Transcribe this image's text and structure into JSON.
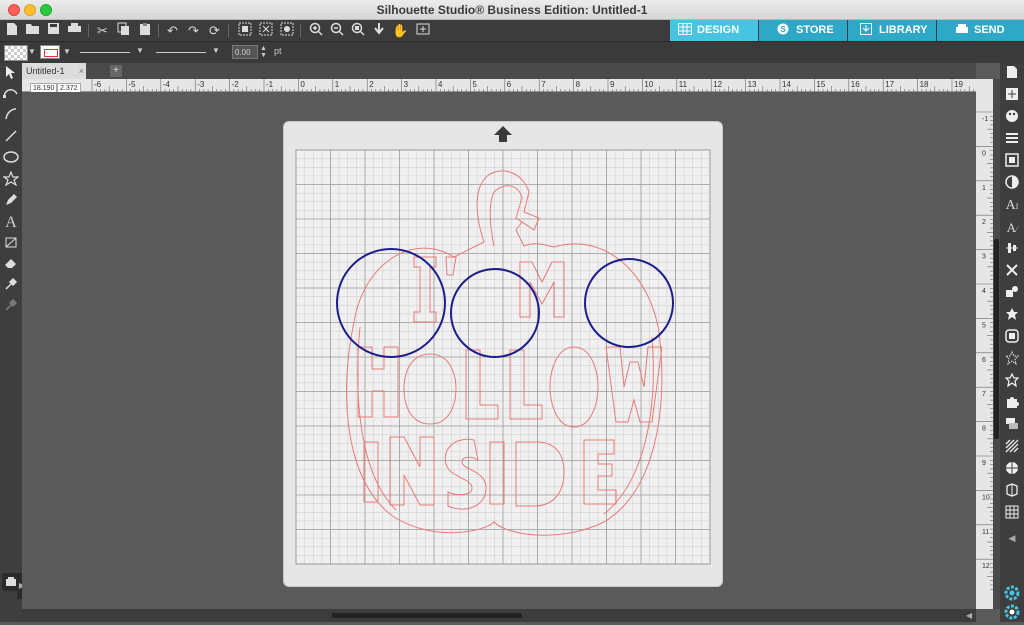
{
  "window": {
    "title": "Silhouette Studio® Business Edition: Untitled-1"
  },
  "nav_tabs": [
    {
      "label": "DESIGN",
      "active": true
    },
    {
      "label": "STORE",
      "active": false
    },
    {
      "label": "LIBRARY",
      "active": false
    },
    {
      "label": "SEND",
      "active": false
    }
  ],
  "toolbar": {
    "icons": [
      "new-icon",
      "open-icon",
      "save-icon",
      "print-icon",
      "cut-icon",
      "copy-icon",
      "paste-icon",
      "undo-icon",
      "redo-icon",
      "redraw-icon",
      "select-all-icon",
      "deselect-icon",
      "group-icon",
      "zoom-in-icon",
      "zoom-out-icon",
      "zoom-fit-icon",
      "move-down-icon",
      "pan-icon",
      "add-page-icon"
    ]
  },
  "props": {
    "line_width": "0.00",
    "line_unit": "pt"
  },
  "document": {
    "tab": "Untitled-1",
    "add_tab": "+"
  },
  "coords": {
    "x": "18.190",
    "y": "2.372"
  },
  "rulers": {
    "h": [
      "-6",
      "-5",
      "-4",
      "-3",
      "-2",
      "-1",
      "0",
      "1",
      "2",
      "3",
      "4",
      "5",
      "6",
      "7",
      "8",
      "9",
      "10",
      "11",
      "12",
      "13",
      "14",
      "15",
      "16",
      "17",
      "18",
      "19"
    ],
    "v": [
      "-1",
      "0",
      "1",
      "2",
      "3",
      "4",
      "5",
      "6",
      "7",
      "8",
      "9",
      "10",
      "11",
      "12"
    ]
  },
  "design": {
    "words": [
      "I'M",
      "HOLLOW",
      "INSIDE"
    ],
    "colors": {
      "guide": "#e87b78",
      "circle": "#1c1f8a",
      "grid": "#c4c4c4",
      "mat": "#f0f0f0"
    }
  },
  "colors": {
    "accent": "#46c4e1",
    "accent_dark": "#2fa8c8"
  }
}
